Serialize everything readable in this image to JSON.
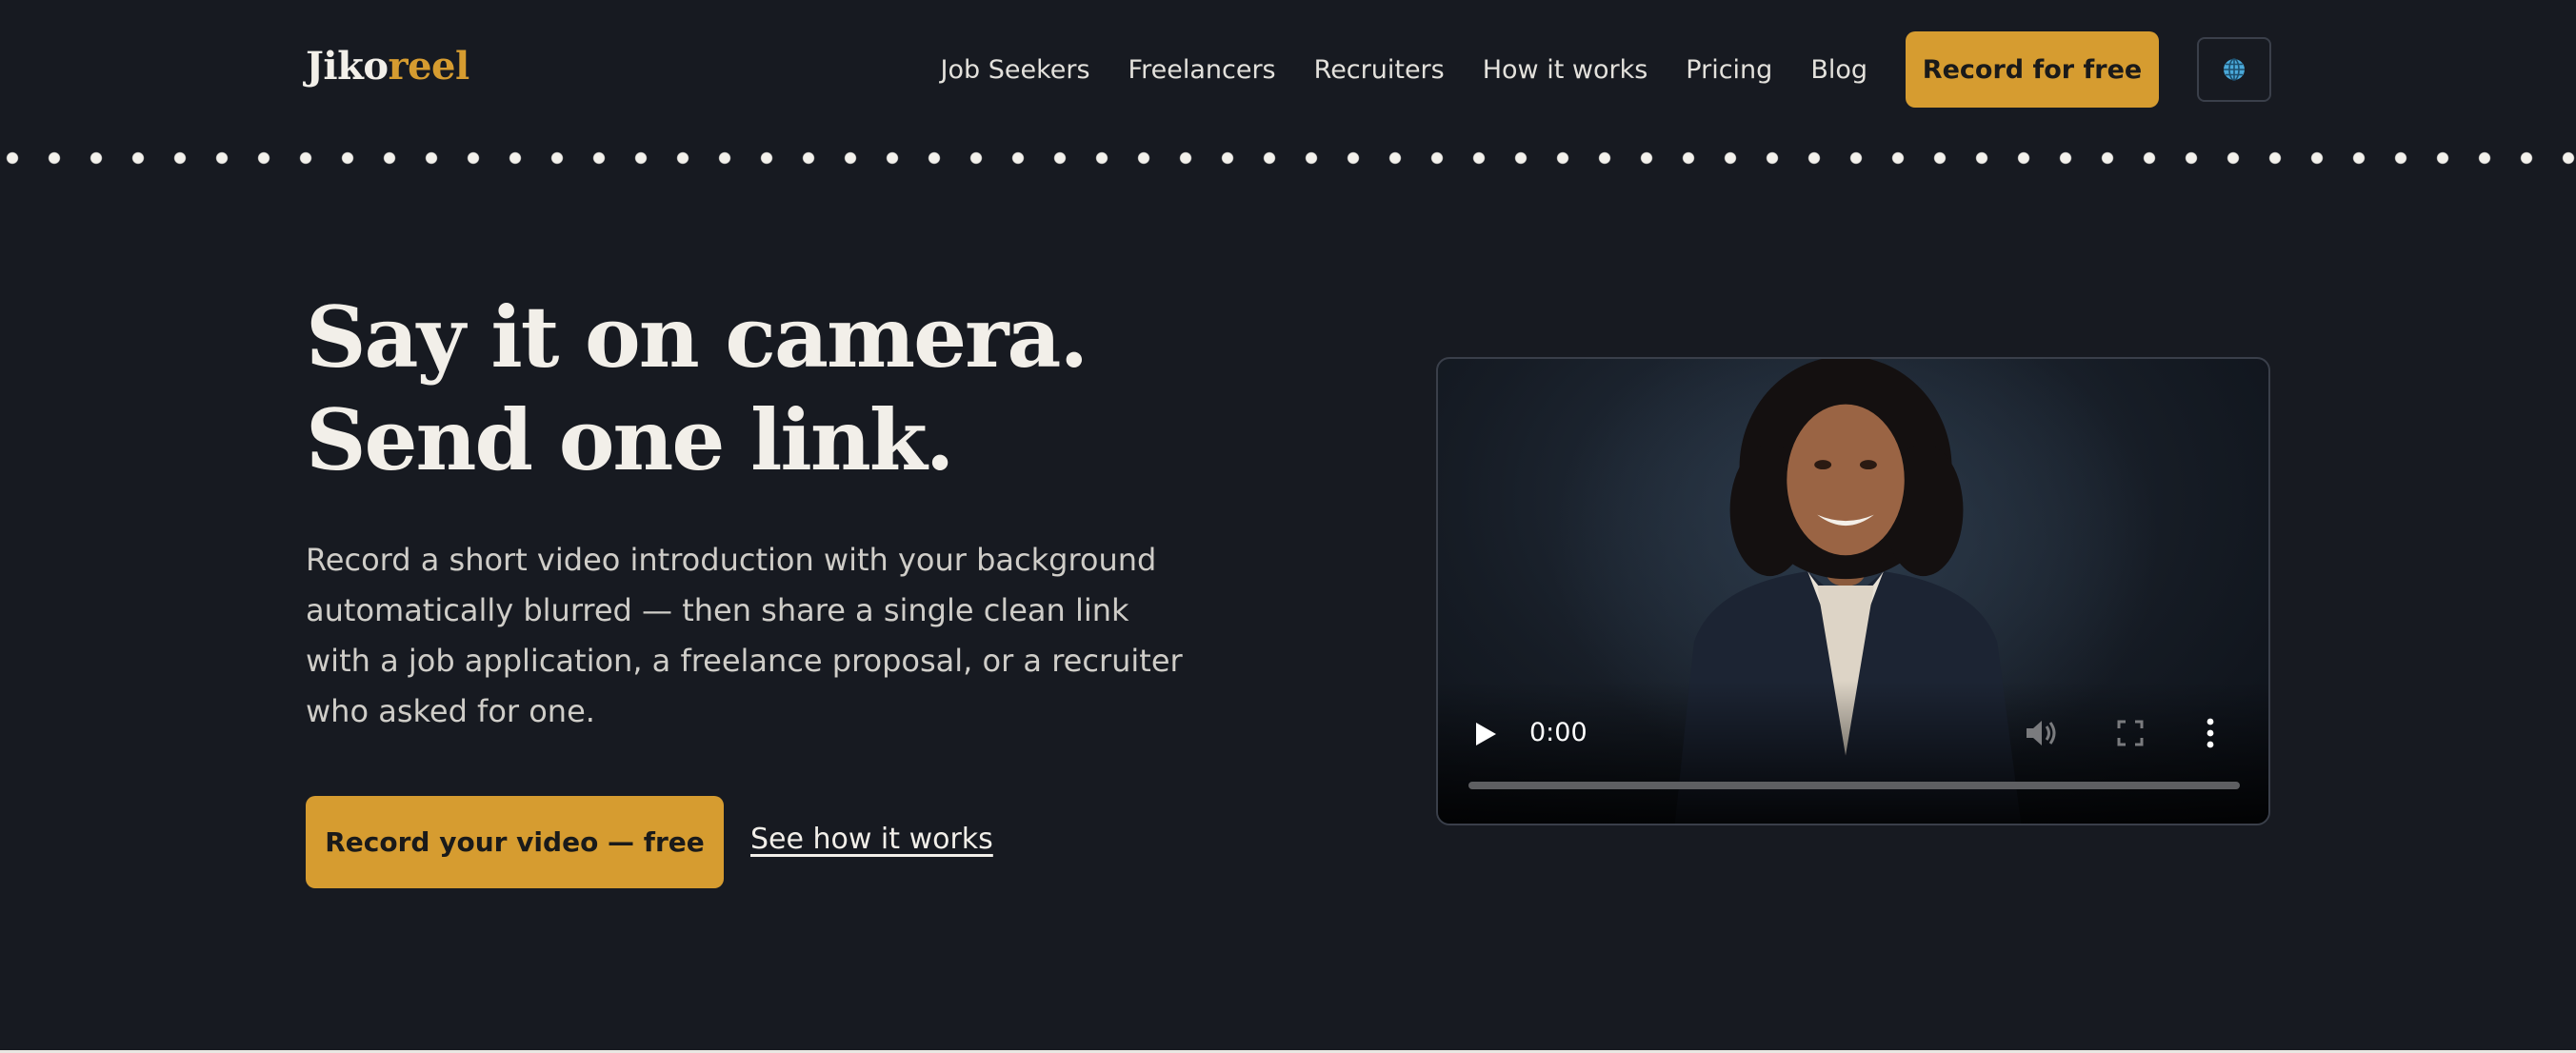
{
  "brand": {
    "logo_part1": "Jiko",
    "logo_part2": "reel",
    "accent_color": "#d69c30",
    "background_color": "#171a21"
  },
  "nav": {
    "items": [
      "Job Seekers",
      "Freelancers",
      "Recruiters",
      "How it works",
      "Pricing",
      "Blog"
    ],
    "cta_label": "Record for free",
    "language_icon": "globe-icon"
  },
  "hero": {
    "title_line1": "Say it on camera.",
    "title_line2": "Send one link.",
    "description": "Record a short video introduction with your background automatically blurred — then share a single clean link with a job application, a freelance proposal, or a recruiter who asked for one.",
    "primary_cta": "Record your video — free",
    "secondary_link": "See how it works"
  },
  "video": {
    "time": "0:00",
    "progress": 0,
    "controls": [
      "play-icon",
      "volume-icon",
      "fullscreen-icon",
      "more-options-icon"
    ]
  }
}
